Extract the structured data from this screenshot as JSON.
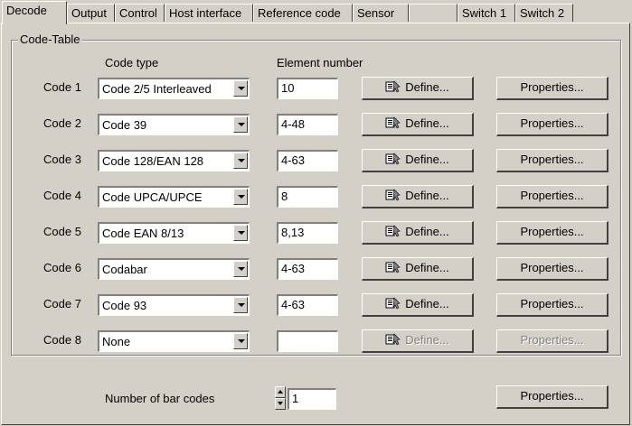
{
  "tabs": [
    "Decode",
    "Output",
    "Control",
    "Host interface",
    "Reference code",
    "Sensor",
    "",
    "Switch 1",
    "Switch 2"
  ],
  "group_title": "Code-Table",
  "headers": {
    "code_type": "Code type",
    "element_number": "Element number"
  },
  "rows": [
    {
      "label": "Code 1",
      "type": "Code 2/5 Interleaved",
      "elements": "10",
      "define": "Define...",
      "properties": "Properties...",
      "enabled": true
    },
    {
      "label": "Code 2",
      "type": "Code 39",
      "elements": "4-48",
      "define": "Define...",
      "properties": "Properties...",
      "enabled": true
    },
    {
      "label": "Code 3",
      "type": "Code 128/EAN 128",
      "elements": "4-63",
      "define": "Define...",
      "properties": "Properties...",
      "enabled": true
    },
    {
      "label": "Code 4",
      "type": "Code UPCA/UPCE",
      "elements": "8",
      "define": "Define...",
      "properties": "Properties...",
      "enabled": true
    },
    {
      "label": "Code 5",
      "type": "Code EAN 8/13",
      "elements": "8,13",
      "define": "Define...",
      "properties": "Properties...",
      "enabled": true
    },
    {
      "label": "Code 6",
      "type": "Codabar",
      "elements": "4-63",
      "define": "Define...",
      "properties": "Properties...",
      "enabled": true
    },
    {
      "label": "Code 7",
      "type": "Code 93",
      "elements": "4-63",
      "define": "Define...",
      "properties": "Properties...",
      "enabled": true
    },
    {
      "label": "Code 8",
      "type": "None",
      "elements": "",
      "define": "Define...",
      "properties": "Properties...",
      "enabled": false
    }
  ],
  "bar_codes": {
    "label": "Number of bar codes",
    "value": "1",
    "properties": "Properties..."
  },
  "icons": {
    "define": "define-icon",
    "spin_up": "spin-up-icon",
    "spin_down": "spin-down-icon"
  }
}
